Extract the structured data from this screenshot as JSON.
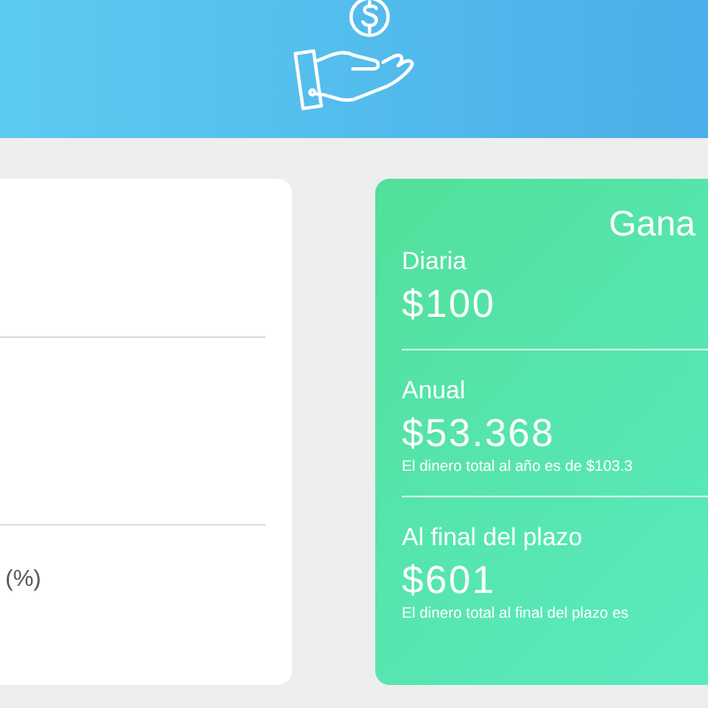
{
  "left_card": {
    "unit_label": "(%)"
  },
  "earnings_card": {
    "title": "Gana",
    "sections": [
      {
        "label": "Diaria",
        "amount": "$100"
      },
      {
        "label": "Anual",
        "amount": "$53.368",
        "note": "El dinero total al año es de $103.3"
      },
      {
        "label": "Al final del plazo",
        "amount": "$601",
        "note": "El dinero total al final del plazo es"
      }
    ]
  }
}
